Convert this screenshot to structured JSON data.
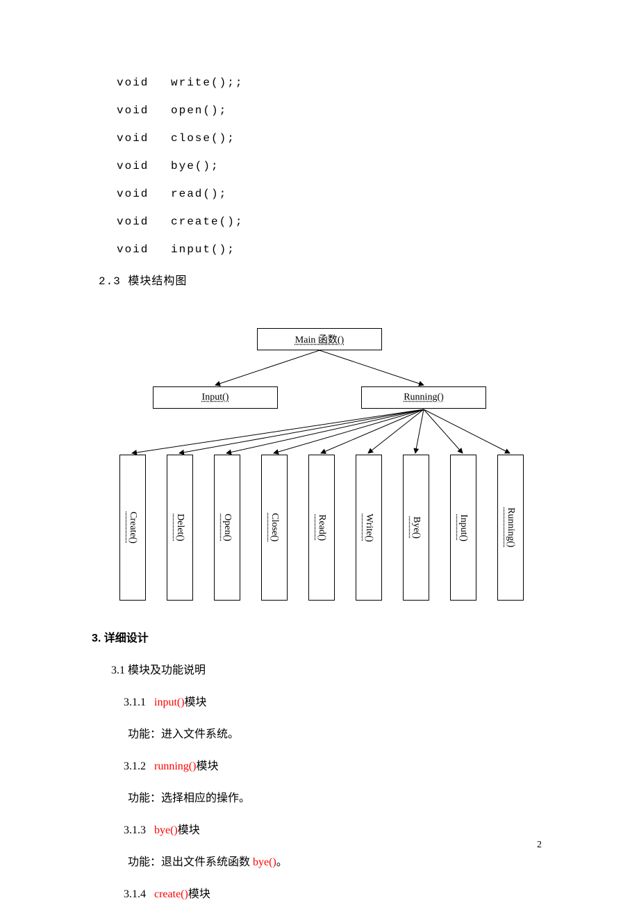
{
  "code": [
    {
      "kw": "void",
      "fn": "write();;"
    },
    {
      "kw": "void",
      "fn": "open();"
    },
    {
      "kw": "void",
      "fn": "close();"
    },
    {
      "kw": "void",
      "fn": "bye();"
    },
    {
      "kw": "void",
      "fn": "read();"
    },
    {
      "kw": "void",
      "fn": "create();"
    },
    {
      "kw": "void",
      "fn": "input();"
    }
  ],
  "sec23": "2.3 模块结构图",
  "diagram": {
    "root": "Main 函数()",
    "mid": [
      "Input()",
      "Running()"
    ],
    "leaves": [
      "Create()",
      "Delet()",
      "Open()",
      "Close()",
      "Read()",
      "Write()",
      "Bye()",
      "Input()",
      "Running()"
    ]
  },
  "h3": "3. 详细设计",
  "s31": "3.1  模块及功能说明",
  "items": [
    {
      "num": "3.1.1",
      "red": "input()",
      "tail": "模块",
      "desc_pre": "功能：进入文件系统。",
      "desc_red": ""
    },
    {
      "num": "3.1.2",
      "red": "running()",
      "tail": "模块",
      "desc_pre": "功能：选择相应的操作。",
      "desc_red": ""
    },
    {
      "num": "3.1.3",
      "red": "bye()",
      "tail": "模块",
      "desc_pre": "功能：退出文件系统函数 ",
      "desc_red": "bye()",
      "desc_post": "。"
    },
    {
      "num": "3.1.4",
      "red": "create()",
      "tail": "模块",
      "desc_pre": "",
      "desc_red": ""
    }
  ],
  "page": "2"
}
